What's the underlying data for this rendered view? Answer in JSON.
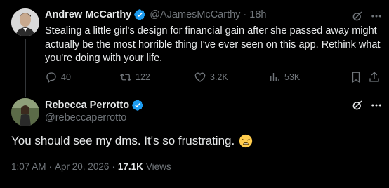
{
  "tweet1": {
    "author_name": "Andrew McCarthy",
    "author_handle": "@AJamesMcCarthy",
    "separator": "·",
    "time": "18h",
    "text": "Stealing a little girl's design for financial gain after she passed away might actually be the most horrible thing I've ever seen on this app. Rethink what you're doing with your life.",
    "replies": "40",
    "retweets": "122",
    "likes": "3.2K",
    "views": "53K",
    "icons": [
      "verified-badge-icon",
      "grok-icon",
      "more-icon",
      "reply-icon",
      "retweet-icon",
      "like-icon",
      "views-icon",
      "bookmark-icon",
      "share-icon"
    ]
  },
  "tweet2": {
    "author_name": "Rebecca Perrotto",
    "author_handle": "@rebeccaperrotto",
    "text": "You should see my dms. It's so frustrating.",
    "emoji": "weary-face-emoji",
    "time": "1:07 AM",
    "separator": "·",
    "date": "Apr 20, 2026",
    "views_count": "17.1K",
    "views_label": "Views",
    "icons": [
      "verified-badge-icon",
      "grok-icon",
      "more-icon"
    ]
  },
  "colors": {
    "background": "#000000",
    "text_primary": "#e7e9ea",
    "text_secondary": "#71767b",
    "verified_blue": "#1d9bf0",
    "thread_line": "#333639"
  }
}
